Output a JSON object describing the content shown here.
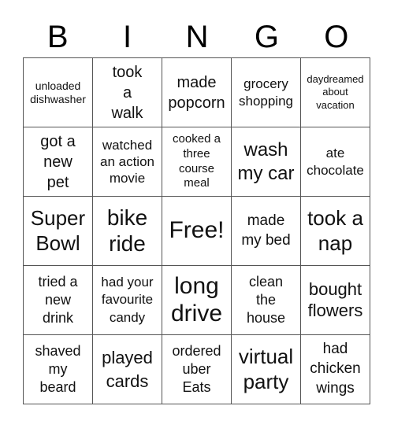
{
  "header": {
    "letters": [
      "B",
      "I",
      "N",
      "G",
      "O"
    ]
  },
  "cells": [
    "unloaded dishwasher",
    "took a walk",
    "made popcorn",
    "grocery shopping",
    "daydreamed about vacation",
    "got a new pet",
    "watched an action movie",
    "cooked a three course meal",
    "wash my car",
    "ate chocolate",
    "Super Bowl",
    "bike ride",
    "Free!",
    "made my bed",
    "took a nap",
    "tried a new drink",
    "had your favourite candy",
    "long drive",
    "clean the house",
    "bought flowers",
    "shaved my beard",
    "played cards",
    "ordered uber Eats",
    "virtual party",
    "had chicken wings"
  ]
}
